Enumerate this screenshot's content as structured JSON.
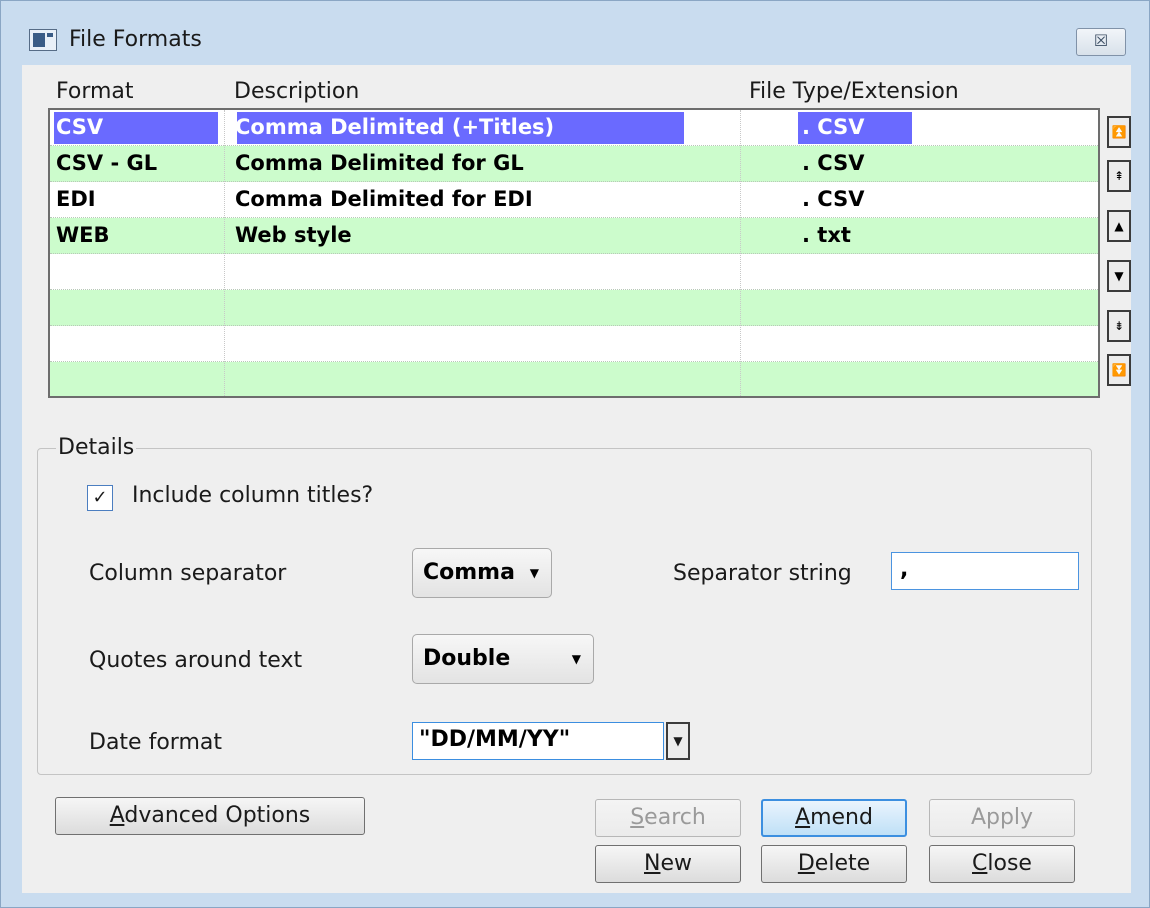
{
  "window": {
    "title": "File Formats",
    "close_glyph": "☒"
  },
  "columns": {
    "format": "Format",
    "description": "Description",
    "file_type": "File Type/Extension"
  },
  "rows": [
    {
      "format": "CSV",
      "description": "Comma Delimited (+Titles)",
      "extension": ". CSV",
      "selected": true
    },
    {
      "format": "CSV - GL",
      "description": "Comma Delimited for GL",
      "extension": ". CSV"
    },
    {
      "format": "EDI",
      "description": "Comma Delimited for EDI",
      "extension": ". CSV"
    },
    {
      "format": "WEB",
      "description": "Web style",
      "extension": ". txt"
    }
  ],
  "scroll_icons": [
    "scroll-top-icon",
    "page-up-icon",
    "line-up-icon",
    "line-down-icon",
    "page-down-icon",
    "scroll-bottom-icon"
  ],
  "details": {
    "legend": "Details",
    "include_titles_label": "Include column titles?",
    "include_titles_checked": "✓",
    "column_separator_label": "Column separator",
    "column_separator_value": "Comma",
    "separator_string_label": "Separator string",
    "separator_string_value": ",",
    "quotes_label": "Quotes around text",
    "quotes_value": "Double",
    "date_format_label": "Date format",
    "date_format_value": "\"DD/MM/YY\""
  },
  "buttons": {
    "advanced_options": {
      "first": "A",
      "rest": "dvanced Options"
    },
    "search": {
      "first": "S",
      "rest": "earch"
    },
    "amend": {
      "first": "A",
      "rest": "mend"
    },
    "apply": {
      "first": "",
      "rest": "Apply"
    },
    "new": {
      "first": "N",
      "rest": "ew"
    },
    "delete": {
      "first": "D",
      "rest": "elete"
    },
    "close": {
      "first": "C",
      "rest": "lose"
    }
  },
  "colors": {
    "selection": "#6a6aff",
    "row_green": "#ccfccc",
    "window_frame": "#c9dcef",
    "default_button": "#3c8fe0"
  }
}
